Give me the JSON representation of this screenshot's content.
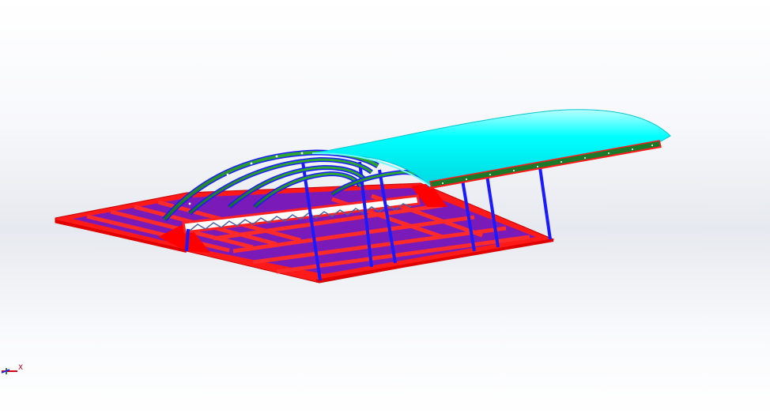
{
  "viewport": {
    "background": [
      "#ffffff",
      "#e6e9ef"
    ]
  },
  "model": {
    "roof_color": "#00ffff",
    "arch_color": "#2a8a2a",
    "column_color": "#1a1aff",
    "floor_frame_color": "#ff1a1a",
    "floor_panel_color": "#7a1ab8"
  },
  "triad": {
    "x_label": "X",
    "icon": "coordinate-triad-icon"
  }
}
